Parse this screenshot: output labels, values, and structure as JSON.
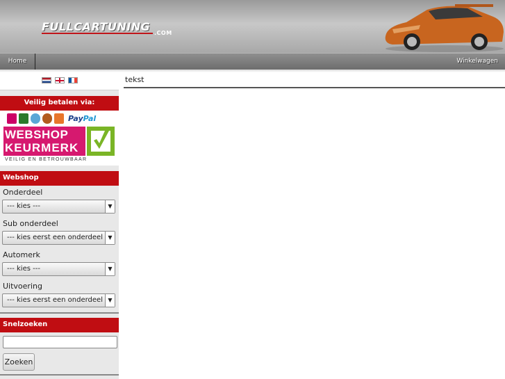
{
  "header": {
    "logo_text": "FULLCARTUNING",
    "logo_suffix": ".COM"
  },
  "nav": {
    "home_label": "Home",
    "cart_label": "Winkelwagen"
  },
  "languages": [
    "nl",
    "en",
    "fr"
  ],
  "payment": {
    "title": "Veilig betalen via:",
    "paypal_a": "Pay",
    "paypal_b": "Pal"
  },
  "keurmerk": {
    "line1": "WEBSHOP",
    "line2": "KEURMERK",
    "subline": "VEILIG EN BETROUWBAAR"
  },
  "webshop": {
    "title": "Webshop",
    "onderdeel_label": "Onderdeel",
    "onderdeel_value": "--- kies ---",
    "sub_label": "Sub onderdeel",
    "sub_value": "--- kies eerst een onderdeel ---",
    "automerk_label": "Automerk",
    "automerk_value": "--- kies ---",
    "uitvoering_label": "Uitvoering",
    "uitvoering_value": "--- kies eerst een onderdeel ---"
  },
  "search": {
    "title": "Snelzoeken",
    "value": "",
    "button_label": "Zoeken"
  },
  "content": {
    "text": "tekst"
  },
  "colors": {
    "accent_red": "#c00d12",
    "nav_gray": "#6d6d6d",
    "car_orange": "#c8651f"
  }
}
